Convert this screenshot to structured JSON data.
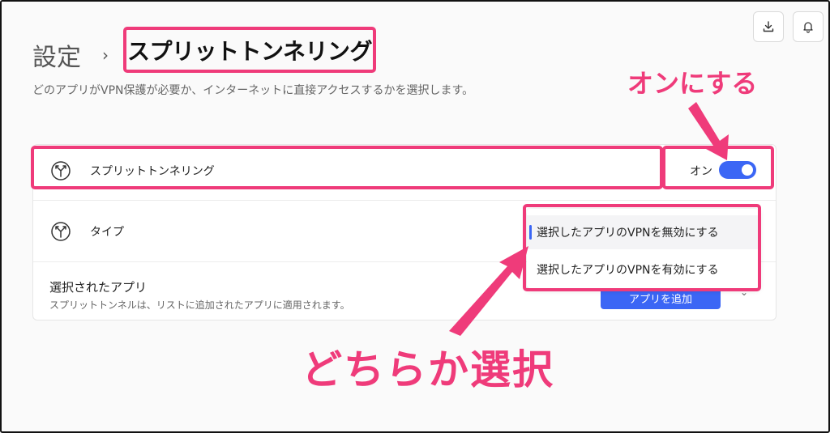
{
  "header": {
    "breadcrumb_root": "設定",
    "breadcrumb_separator": "›",
    "page_title": "スプリットトンネリング",
    "description": "どのアプリがVPN保護が必要か、インターネットに直接アクセスするかを選択します。"
  },
  "toolbar": {
    "download_icon": "download-icon",
    "bell_icon": "bell-icon"
  },
  "split_row": {
    "icon": "split-arrows-icon",
    "label": "スプリットトンネリング",
    "toggle_text": "オン",
    "toggle_on": true
  },
  "type_row": {
    "icon": "split-arrows-icon",
    "label": "タイプ",
    "options": [
      "選択したアプリのVPNを無効にする",
      "選択したアプリのVPNを有効にする"
    ],
    "selected_index": 0
  },
  "apps_row": {
    "title": "選択されたアプリ",
    "description": "スプリットトンネルは、リストに追加されたアプリに適用されます。",
    "button_label": "アプリを追加"
  },
  "annotations": {
    "toggle_note": "オンにする",
    "choose_note": "どちらか選択"
  },
  "colors": {
    "highlight": "#ef3b7a",
    "accent": "#3b66f5"
  }
}
